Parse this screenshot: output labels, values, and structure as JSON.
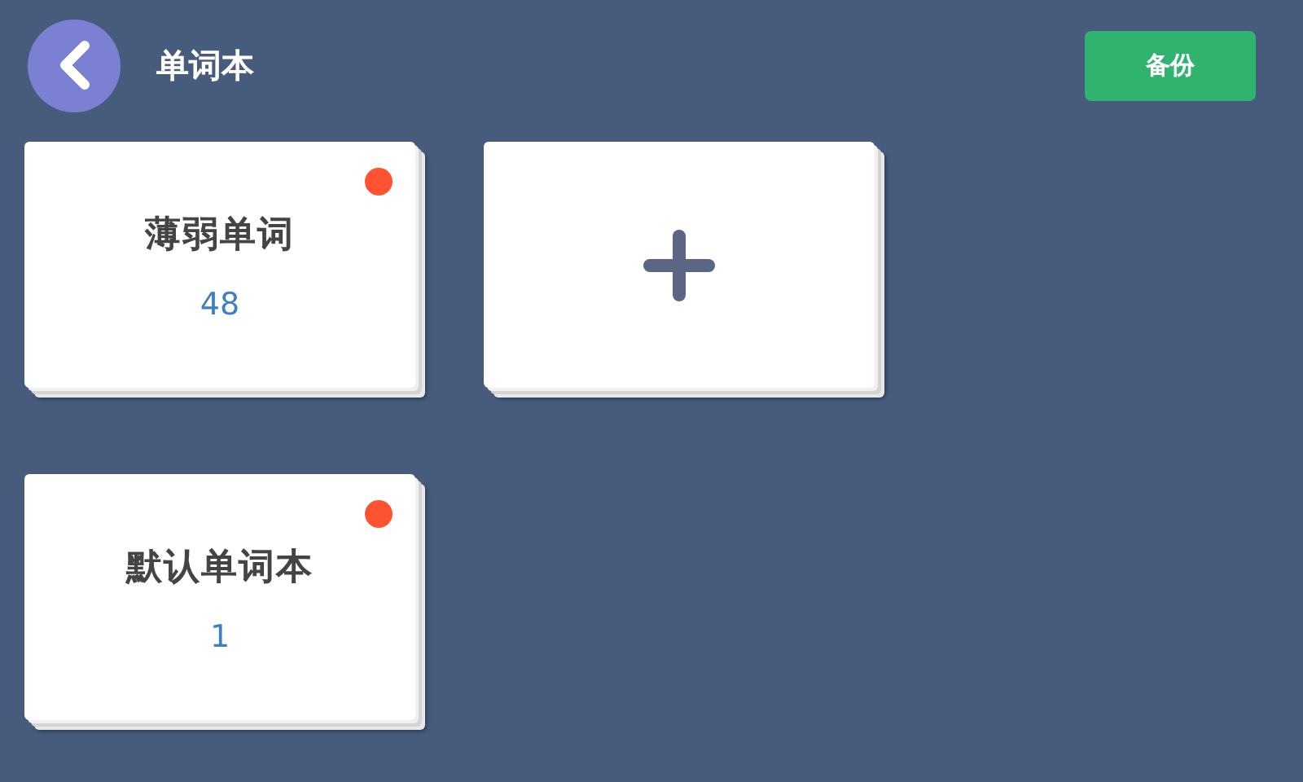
{
  "header": {
    "title": "单词本",
    "backup_button": "备份"
  },
  "cards": [
    {
      "kind": "book",
      "name": "薄弱单词",
      "count": "48",
      "has_new": true
    },
    {
      "kind": "add"
    },
    {
      "kind": "book",
      "name": "默认单词本",
      "count": "1",
      "has_new": true
    }
  ]
}
